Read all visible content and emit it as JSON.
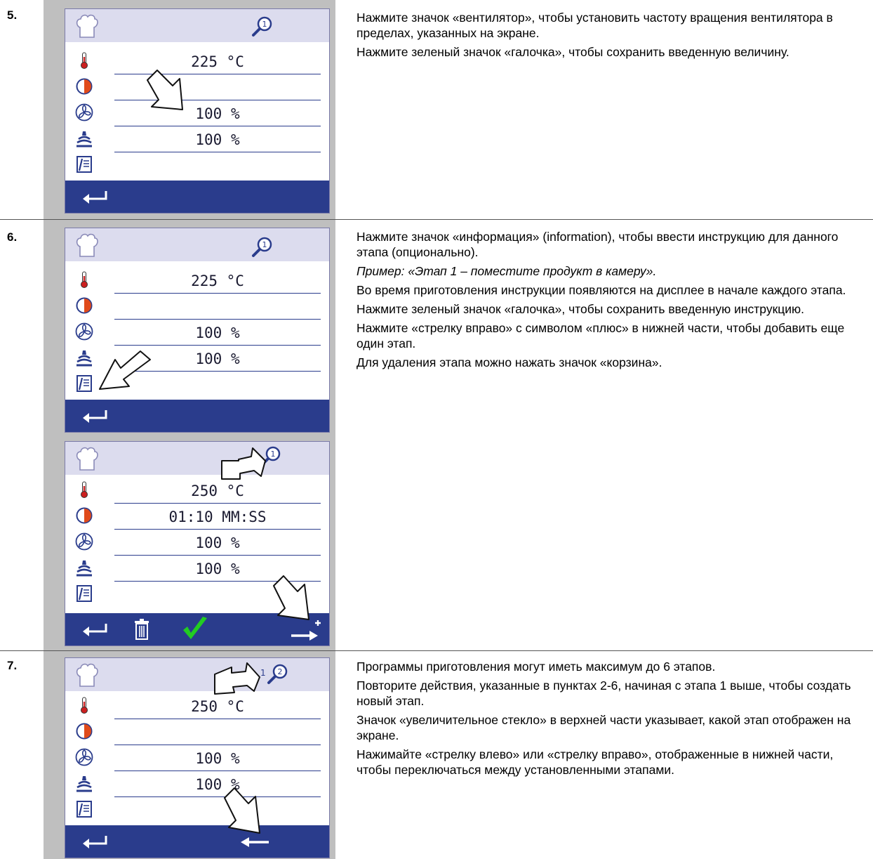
{
  "steps": [
    {
      "number": "5.",
      "paragraphs": [
        "Нажмите значок «вентилятор», чтобы установить частоту вращения вентилятора в пределах, указанных на экране.",
        "Нажмите зеленый значок «галочка», чтобы сохранить введенную величину."
      ]
    },
    {
      "number": "6.",
      "paragraphs": [
        "Нажмите значок «информация» (information), чтобы ввести инструкцию для данного этапа (опционально).",
        "Пример: «Этап 1 – поместите продукт в камеру».",
        "Во время приготовления инструкции появляются на дисплее в начале каждого этапа.",
        "Нажмите зеленый значок «галочка», чтобы сохранить введенную инструкцию.",
        "Нажмите «стрелку вправо» с символом «плюс» в нижней части, чтобы добавить еще один этап.",
        "Для удаления этапа можно нажать значок «корзина»."
      ]
    },
    {
      "number": "7.",
      "paragraphs": [
        "Программы приготовления могут иметь максимум до 6 этапов.",
        "Повторите действия, указанные в пунктах 2-6, начиная с этапа 1 выше, чтобы создать новый этап.",
        "Значок «увеличительное стекло» в верхней части указывает, какой этап отображен на экране.",
        "Нажимайте «стрелку влево» или «стрелку вправо», отображенные в нижней части, чтобы переключаться между установленными этапами."
      ]
    }
  ],
  "screens": [
    {
      "stage": "1",
      "prev_stage": "",
      "temperature": "225 °C",
      "time": "",
      "fan": "100 %",
      "humidity": "100 %"
    },
    {
      "stage": "1",
      "prev_stage": "",
      "temperature": "225 °C",
      "time": "",
      "fan": "100 %",
      "humidity": "100 %"
    },
    {
      "stage": "1",
      "prev_stage": "",
      "temperature": "250 °C",
      "time": "01:10 MM:SS",
      "fan": "100 %",
      "humidity": "100 %"
    },
    {
      "stage": "2",
      "prev_stage": "1",
      "temperature": "250 °C",
      "time": "",
      "fan": "100 %",
      "humidity": "100 %"
    }
  ],
  "colors": {
    "screen_header": "#dcdcee",
    "screen_footer": "#2a3c8c",
    "gray_column": "#bfbfbf",
    "check_green": "#22cc22",
    "thermometer_red": "#cc2020",
    "timer_orange": "#e04a1a"
  }
}
